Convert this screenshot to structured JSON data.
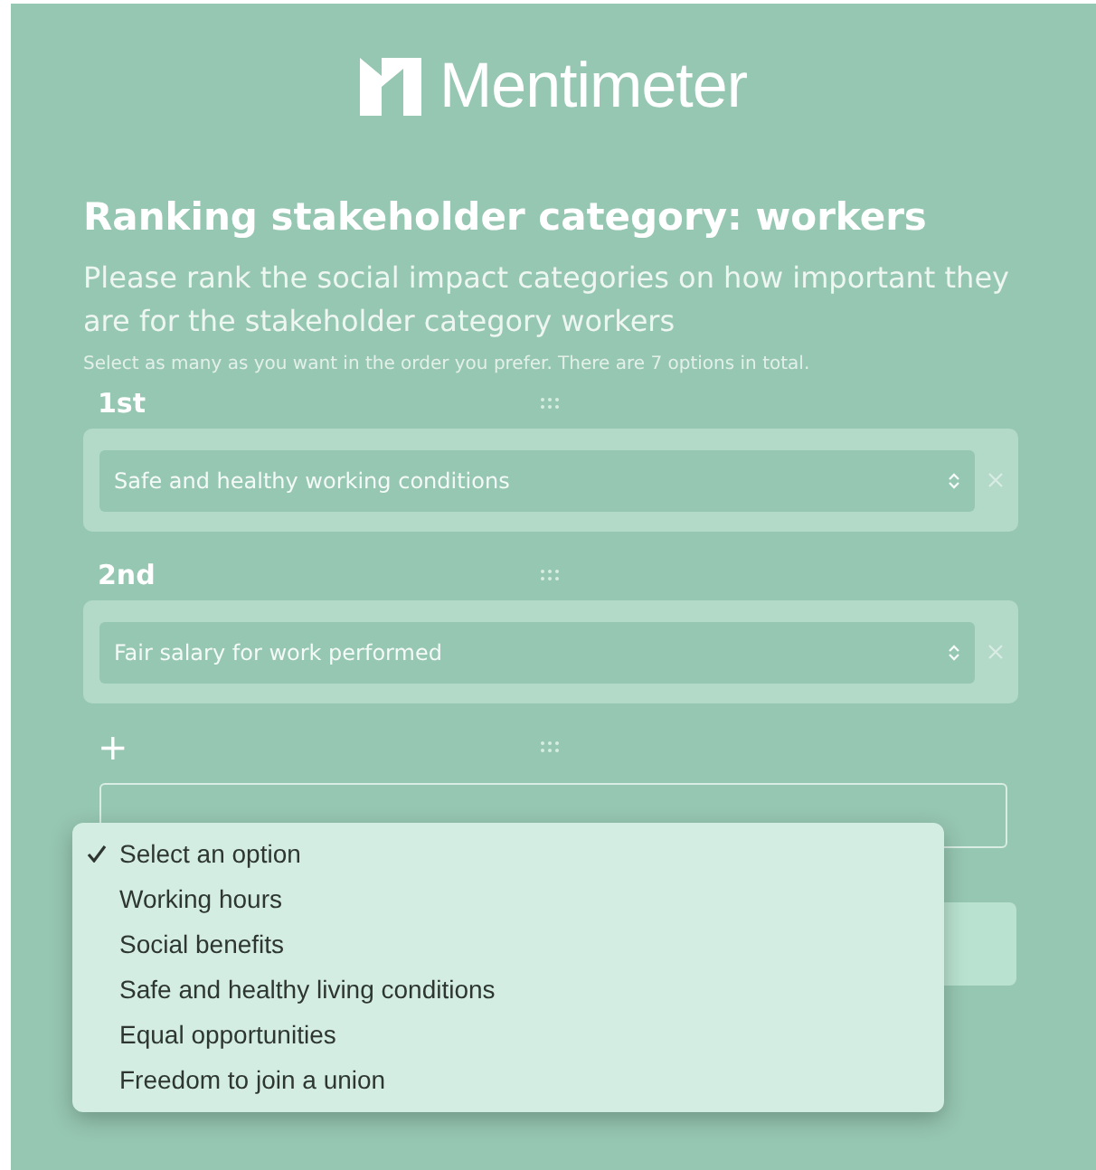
{
  "logo": {
    "text": "Mentimeter"
  },
  "question": {
    "title": "Ranking stakeholder category: workers",
    "description": "Please rank the social impact categories on how important they are for the stakeholder category workers",
    "hint": "Select as many as you want in the order you prefer. There are 7 options in total."
  },
  "ranks": [
    {
      "label": "1st",
      "value": "Safe and healthy working conditions"
    },
    {
      "label": "2nd",
      "value": "Fair salary for work performed"
    },
    {
      "label": "+",
      "kind": "add"
    }
  ],
  "dropdown": {
    "options": [
      {
        "label": "Select an option",
        "selected": true
      },
      {
        "label": "Working hours",
        "selected": false
      },
      {
        "label": "Social benefits",
        "selected": false
      },
      {
        "label": "Safe and healthy living conditions",
        "selected": false
      },
      {
        "label": "Equal opportunities",
        "selected": false
      },
      {
        "label": "Freedom to join a union",
        "selected": false
      }
    ]
  }
}
